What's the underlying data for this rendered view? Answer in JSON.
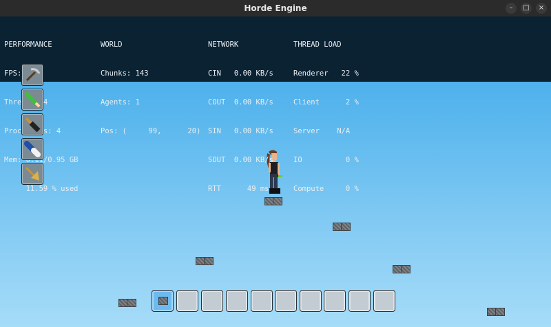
{
  "window": {
    "title": "Horde Engine",
    "controls": {
      "minimize": "–",
      "maximize": "□",
      "close": "×"
    }
  },
  "hud": {
    "performance": {
      "heading": "PERFORMANCE",
      "fps": "FPS:  99",
      "threads": "Threads: 4",
      "processors": "Processors: 4",
      "mem": "Mem: 0.11/0.95 GB",
      "used": "     11.59 % used"
    },
    "world": {
      "heading": "WORLD",
      "chunks": "Chunks: 143",
      "agents": "Agents: 1",
      "pos": "Pos: (     99,      20)"
    },
    "network": {
      "heading": "NETWORK",
      "cin": "CIN   0.00 KB/s",
      "cout": "COUT  0.00 KB/s",
      "sin": "SIN   0.00 KB/s",
      "sout": "SOUT  0.00 KB/s",
      "rtt": "RTT      49 ms"
    },
    "thread_load": {
      "heading": "THREAD LOAD",
      "renderer": "Renderer   22 %",
      "client": "Client      2 %",
      "server": "Server    N/A",
      "io": "IO          0 %",
      "compute": "Compute     0 %"
    }
  },
  "toolbar": {
    "tools": [
      {
        "name": "pickaxe-tool",
        "icon": "pickaxe-icon"
      },
      {
        "name": "pencil-tool",
        "icon": "pencil-icon"
      },
      {
        "name": "brush-tool",
        "icon": "paint-brush-icon"
      },
      {
        "name": "eraser-tool",
        "icon": "eraser-icon"
      },
      {
        "name": "broom-tool",
        "icon": "broom-icon"
      }
    ]
  },
  "hotbar": {
    "slot_count": 10,
    "selected_slot": 1,
    "first_slot_item": "stone-block-icon"
  },
  "colors": {
    "sky_top": "#3ba6e8",
    "sky_bottom": "#a6dcf8",
    "hud_bg": "#0b2233",
    "selected_slot": "#6cbaf0"
  }
}
